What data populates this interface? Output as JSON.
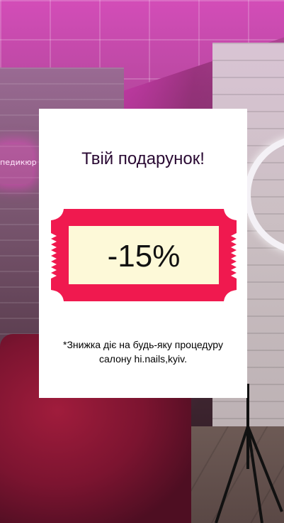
{
  "popup": {
    "title": "Твій подарунок!",
    "discount": "-15%",
    "note": "*Знижка діє на будь-яку процедуру салону hi.nails,kyiv."
  },
  "background": {
    "neon_sign_text": "педикюр",
    "colors": {
      "ticket_red": "#f0194f",
      "ticket_inner": "#fdf9d8",
      "title_color": "#2a0a33"
    }
  }
}
